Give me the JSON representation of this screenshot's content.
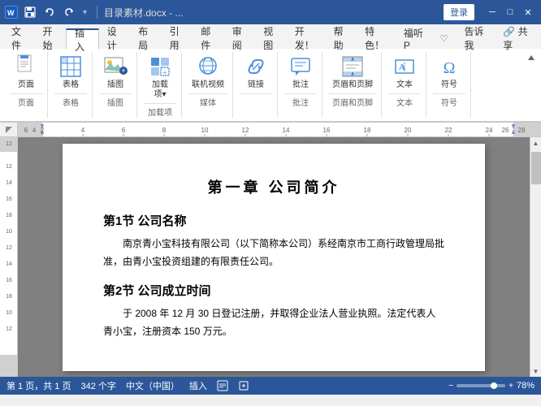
{
  "titleBar": {
    "title": "目录素材.docx - ...",
    "loginLabel": "登录",
    "saveIcon": "save-icon",
    "undoIcon": "undo-icon",
    "redoIcon": "redo-icon",
    "minimize": "─",
    "maximize": "□",
    "close": "✕"
  },
  "tabs": [
    {
      "id": "file",
      "label": "文件"
    },
    {
      "id": "start",
      "label": "开始"
    },
    {
      "id": "insert",
      "label": "插入",
      "active": true
    },
    {
      "id": "design",
      "label": "设计"
    },
    {
      "id": "layout",
      "label": "布局"
    },
    {
      "id": "references",
      "label": "引用"
    },
    {
      "id": "mail",
      "label": "邮件"
    },
    {
      "id": "review",
      "label": "审阅"
    },
    {
      "id": "view",
      "label": "视图"
    },
    {
      "id": "develop",
      "label": "开发！"
    },
    {
      "id": "help",
      "label": "帮助"
    },
    {
      "id": "special1",
      "label": "特色！"
    },
    {
      "id": "fusp",
      "label": "福听P"
    },
    {
      "id": "light",
      "label": "♡"
    },
    {
      "id": "tellme",
      "label": "告诉我"
    },
    {
      "id": "share",
      "label": "♢ 共享"
    }
  ],
  "ribbonGroups": [
    {
      "id": "pages",
      "label": "页面",
      "items": [
        {
          "id": "page",
          "label": "页面",
          "icon": "page-icon"
        }
      ]
    },
    {
      "id": "tables",
      "label": "表格",
      "items": [
        {
          "id": "table",
          "label": "表格",
          "icon": "table-icon"
        }
      ]
    },
    {
      "id": "illustrations",
      "label": "插图",
      "items": [
        {
          "id": "picture",
          "label": "插图",
          "icon": "picture-icon"
        }
      ]
    },
    {
      "id": "addins",
      "label": "加载项",
      "items": [
        {
          "id": "addin",
          "label": "加载\n项▾",
          "icon": "addin-icon"
        }
      ]
    },
    {
      "id": "media",
      "label": "媒体",
      "items": [
        {
          "id": "video",
          "label": "联机视频",
          "icon": "video-icon"
        }
      ]
    },
    {
      "id": "links",
      "label": "",
      "items": [
        {
          "id": "link",
          "label": "链接",
          "icon": "link-icon"
        }
      ]
    },
    {
      "id": "comments",
      "label": "批注",
      "items": [
        {
          "id": "comment",
          "label": "批注",
          "icon": "comment-icon"
        }
      ]
    },
    {
      "id": "headerFooter",
      "label": "页眉和页脚",
      "items": [
        {
          "id": "hf",
          "label": "页眉和页脚",
          "icon": "headerfooter-icon"
        }
      ]
    },
    {
      "id": "text",
      "label": "文本",
      "items": [
        {
          "id": "textbox",
          "label": "文本",
          "icon": "textbox-icon"
        }
      ]
    },
    {
      "id": "symbols",
      "label": "符号",
      "items": [
        {
          "id": "symbol",
          "label": "符号",
          "icon": "symbol-icon"
        }
      ]
    }
  ],
  "document": {
    "chapterTitle": "第一章   公司简介",
    "sections": [
      {
        "title": "第1节  公司名称",
        "content": "南京青小宝科技有限公司（以下简称本公司）系经南京市工商行政管理局批准，由青小宝投资组建的有限责任公司。"
      },
      {
        "title": "第2节  公司成立时间",
        "content": "于 2008 年 12 月 30 日登记注册，并取得企业法人营业执照。法定代表人青小宝，注册资本 150 万元。"
      }
    ]
  },
  "statusBar": {
    "pageInfo": "第 1 页，共 1 页",
    "wordCount": "342 个字",
    "language": "中文（中国）",
    "inputMode": "插入",
    "zoom": "78%"
  }
}
